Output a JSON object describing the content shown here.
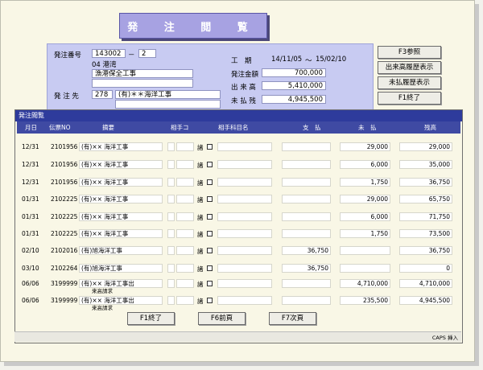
{
  "title": "発 注 閲 覧",
  "form": {
    "order_no_label": "発注番号",
    "order_no": "143002",
    "order_sep": "－",
    "order_branch": "2",
    "port": "04 港湾",
    "project_name": "漁港保全工事",
    "vendor_label": "発 注 先",
    "vendor_code": "278",
    "vendor_name": "(有)＊＊海洋工事",
    "period_label": "工　期",
    "period_start": "14/11/05",
    "period_tilde": "～",
    "period_end": "15/02/10",
    "amount_label": "発注金額",
    "amount": "700,000",
    "completed_label": "出 来 高",
    "completed": "5,410,000",
    "unpaid_label": "未 払 残",
    "unpaid": "4,945,500"
  },
  "side_buttons": [
    "F3参照",
    "出来高履歴表示",
    "未払履歴表示",
    "F1終了"
  ],
  "dialog": {
    "title": "発注閲覧",
    "headers": {
      "date": "月日",
      "slip": "伝票NO",
      "summary": "摘要",
      "partner": "相手コ",
      "partner_acct": "相手科目名",
      "payment": "支　払",
      "unpaid": "未　払",
      "balance": "残高"
    },
    "rows": [
      {
        "date": "12/31",
        "slip": "2101956",
        "summary": "(有)×× 海洋工事",
        "sub": "",
        "payment": "",
        "unpaid": "29,000",
        "balance": "29,000"
      },
      {
        "date": "12/31",
        "slip": "2101956",
        "summary": "(有)×× 海洋工事",
        "sub": "",
        "payment": "",
        "unpaid": "6,000",
        "balance": "35,000"
      },
      {
        "date": "12/31",
        "slip": "2101956",
        "summary": "(有)×× 海洋工事",
        "sub": "",
        "payment": "",
        "unpaid": "1,750",
        "balance": "36,750"
      },
      {
        "date": "01/31",
        "slip": "2102225",
        "summary": "(有)×× 海洋工事",
        "sub": "",
        "payment": "",
        "unpaid": "29,000",
        "balance": "65,750"
      },
      {
        "date": "01/31",
        "slip": "2102225",
        "summary": "(有)×× 海洋工事",
        "sub": "",
        "payment": "",
        "unpaid": "6,000",
        "balance": "71,750"
      },
      {
        "date": "01/31",
        "slip": "2102225",
        "summary": "(有)×× 海洋工事",
        "sub": "",
        "payment": "",
        "unpaid": "1,750",
        "balance": "73,500"
      },
      {
        "date": "02/10",
        "slip": "2102016",
        "summary": "(有)旭海洋工事",
        "sub": "",
        "payment": "36,750",
        "unpaid": "",
        "balance": "36,750"
      },
      {
        "date": "03/10",
        "slip": "2102264",
        "summary": "(有)旭海洋工事",
        "sub": "",
        "payment": "36,750",
        "unpaid": "",
        "balance": "0"
      },
      {
        "date": "06/06",
        "slip": "3199999",
        "summary": "(有)×× 海洋工事出",
        "sub": "来高請求",
        "payment": "",
        "unpaid": "4,710,000",
        "balance": "4,710,000"
      },
      {
        "date": "06/06",
        "slip": "3199999",
        "summary": "(有)×× 海洋工事出",
        "sub": "来高請求",
        "payment": "",
        "unpaid": "235,500",
        "balance": "4,945,500"
      }
    ],
    "row_mark": "諸"
  },
  "footer_buttons": [
    "F1終了",
    "F6前頁",
    "F7次頁"
  ],
  "status": "CAPS 挿入"
}
